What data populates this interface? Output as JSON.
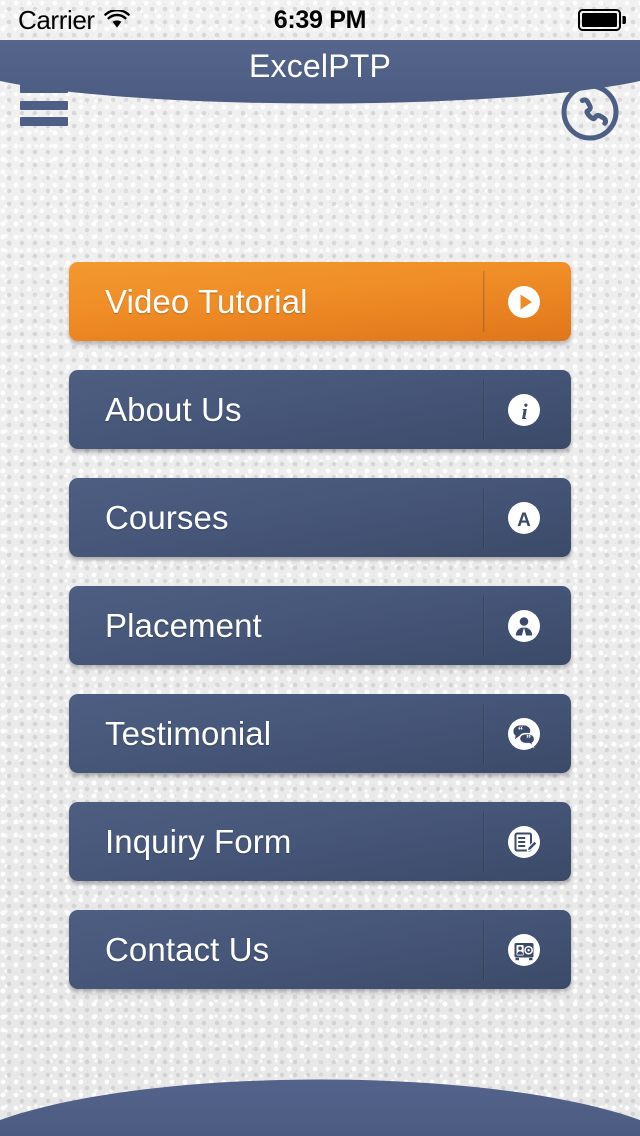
{
  "status_bar": {
    "carrier": "Carrier",
    "wifi_icon": "wifi-icon",
    "time": "6:39 PM",
    "battery_icon": "battery-full-icon"
  },
  "header": {
    "title": "ExcelPTP",
    "menu_icon": "hamburger-menu-icon",
    "phone_icon": "phone-call-icon",
    "bar_color": "#50608a"
  },
  "theme": {
    "background": "#ededed",
    "blue_top": "#4d5e82",
    "blue_bottom": "#3b4a68",
    "orange_top": "#f2992f",
    "orange_bottom": "#e0761b",
    "label_color": "#ffffff"
  },
  "menu": {
    "items": [
      {
        "label": "Video Tutorial",
        "icon": "play-circle-icon",
        "style": "orange"
      },
      {
        "label": "About Us",
        "icon": "info-circle-icon",
        "style": "blue"
      },
      {
        "label": "Courses",
        "icon": "letter-a-circle-icon",
        "style": "blue"
      },
      {
        "label": "Placement",
        "icon": "user-person-circle-icon",
        "style": "blue"
      },
      {
        "label": "Testimonial",
        "icon": "speech-bubbles-circle-icon",
        "style": "blue"
      },
      {
        "label": "Inquiry Form",
        "icon": "form-document-circle-icon",
        "style": "blue"
      },
      {
        "label": "Contact Us",
        "icon": "contact-card-circle-icon",
        "style": "blue"
      }
    ]
  },
  "bottom_bar": {
    "color": "#50608a"
  }
}
